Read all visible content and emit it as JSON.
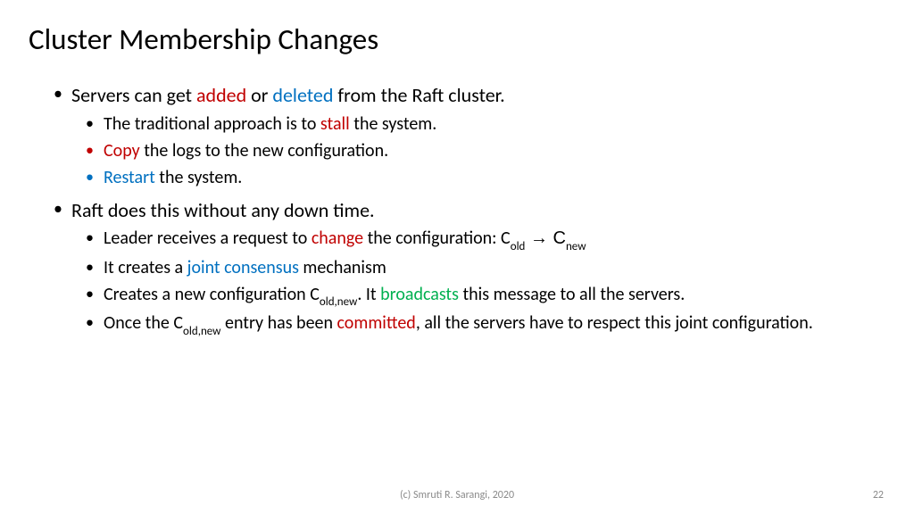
{
  "title": "Cluster Membership Changes",
  "bullets": {
    "b1_pre": "Servers can get ",
    "b1_added": "added",
    "b1_mid": " or ",
    "b1_deleted": "deleted",
    "b1_post": " from the Raft cluster.",
    "b1a_pre": "The traditional approach is to ",
    "b1a_stall": "stall",
    "b1a_post": " the system.",
    "b1b_copy": "Copy",
    "b1b_post": " the logs to the new configuration.",
    "b1c_restart": "Restart",
    "b1c_post": " the system.",
    "b2": "Raft does this without any down time.",
    "b2a_pre": "Leader receives a request to ",
    "b2a_change": "change",
    "b2a_post": " the configuration: C",
    "b2a_old": "old",
    "b2a_arrow": "  →  C",
    "b2a_new": "new",
    "b2b_pre": "It creates a ",
    "b2b_joint": "joint consensus",
    "b2b_post": " mechanism",
    "b2c_pre": "Creates a new configuration C",
    "b2c_oldnew": "old,new",
    "b2c_mid": ". It ",
    "b2c_broad": "broadcasts",
    "b2c_post": " this message to all the servers.",
    "b2d_pre": "Once the C",
    "b2d_oldnew": "old,new",
    "b2d_mid": " entry has been ",
    "b2d_comm": "committed",
    "b2d_post": ", all the servers have to respect this joint configuration."
  },
  "footer": "(c) Smruti R. Sarangi, 2020",
  "page": "22"
}
